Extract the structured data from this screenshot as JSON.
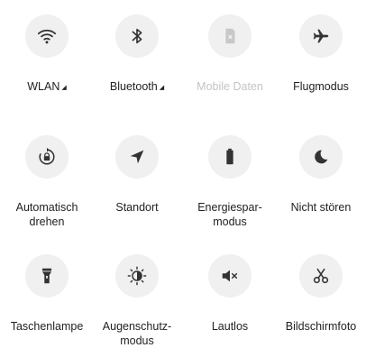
{
  "tiles": [
    {
      "label": "WLAN",
      "icon": "wifi-icon",
      "has_caret": true,
      "caret": "◢"
    },
    {
      "label": "Bluetooth",
      "icon": "bluetooth-icon",
      "has_caret": true,
      "caret": "◢"
    },
    {
      "label": "Mobile Daten",
      "icon": "sim-card-icon",
      "disabled": true
    },
    {
      "label": "Flugmodus",
      "icon": "airplane-icon"
    },
    {
      "label": "Automatisch\ndrehen",
      "icon": "auto-rotate-icon"
    },
    {
      "label": "Standort",
      "icon": "location-arrow-icon"
    },
    {
      "label": "Energiespar-\nmodus",
      "icon": "battery-icon"
    },
    {
      "label": "Nicht stören",
      "icon": "moon-icon"
    },
    {
      "label": "Taschenlampe",
      "icon": "flashlight-icon"
    },
    {
      "label": "Augenschutz-\nmodus",
      "icon": "eye-comfort-sun-icon"
    },
    {
      "label": "Lautlos",
      "icon": "mute-speaker-icon"
    },
    {
      "label": "Bildschirmfoto",
      "icon": "scissors-icon"
    }
  ],
  "colors": {
    "circle_bg": "#f0f0f0",
    "icon": "#333333",
    "icon_disabled": "#c8c8c8",
    "label": "#222222",
    "label_disabled": "#c4c4c4"
  }
}
